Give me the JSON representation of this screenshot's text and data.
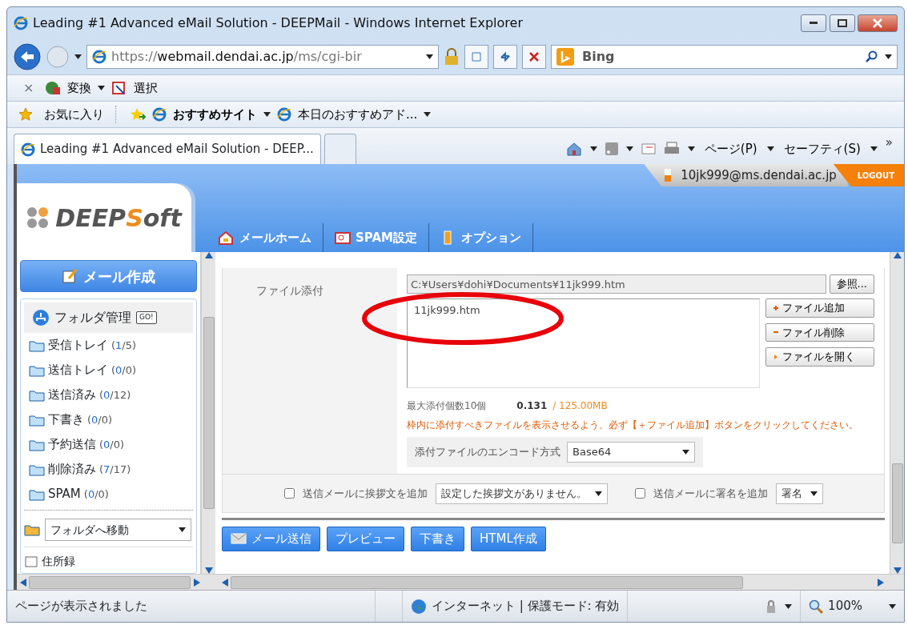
{
  "window": {
    "title": "Leading #1 Advanced eMail Solution - DEEPMail - Windows Internet Explorer"
  },
  "address_bar": {
    "url": "https://**webmail.dendai.ac.jp**/ms/cgi-bir",
    "search_placeholder": "Bing"
  },
  "command_bar": {
    "close_glyph": "×",
    "items": [
      {
        "label": "変換"
      },
      {
        "label": "選択"
      }
    ]
  },
  "favorites_bar": {
    "favorites": "お気に入り",
    "items": [
      {
        "label": "おすすめサイト",
        "kind": "menu"
      },
      {
        "label": "本日のおすすめアド...",
        "kind": "page"
      }
    ]
  },
  "tabs": [
    {
      "label": "Leading #1 Advanced eMail Solution - DEEP...",
      "selected": true
    },
    {
      "selected": false
    }
  ],
  "ie_commands": [
    {
      "label": "ページ(P)"
    },
    {
      "label": "セーフティ(S)"
    }
  ],
  "ie_more": "»",
  "header": {
    "user_email": "10jk999@ms.dendai.ac.jp",
    "logout": "LOGOUT",
    "logo_parts": [
      "DEEP",
      "S",
      "oft"
    ],
    "nav": [
      {
        "label": "メールホーム",
        "kind": "home"
      },
      {
        "label": "SPAM設定",
        "kind": "spam"
      },
      {
        "label": "オプション",
        "kind": "option"
      }
    ]
  },
  "sidebar": {
    "compose": "メール作成",
    "folder_manager": "フォルダ管理",
    "go": "GO!",
    "folders": [
      {
        "name": "受信トレイ",
        "count": "(*1*/5)"
      },
      {
        "name": "送信トレイ",
        "count": "(*0*/0)"
      },
      {
        "name": "送信済み",
        "count": "(*0*/12)"
      },
      {
        "name": "下書き",
        "count": "(*0*/0)"
      },
      {
        "name": "予約送信",
        "count": "(*0*/0)"
      },
      {
        "name": "削除済み",
        "count": "(*7*/17)"
      },
      {
        "name": "SPAM",
        "count": "(*0*/0)"
      }
    ],
    "move_to_folder": "フォルダへ移動",
    "address_book": "住所録"
  },
  "attachment": {
    "label": "ファイル添付",
    "path": "C:¥Users¥dohi¥Documents¥11jk999.htm",
    "browse": "参照...",
    "files": [
      {
        "name": "11jk999.htm",
        "highlighted": true
      }
    ],
    "buttons": [
      {
        "label": "ファイル追加",
        "kind": "add"
      },
      {
        "label": "ファイル削除",
        "kind": "remove"
      },
      {
        "label": "ファイルを開く",
        "kind": "open"
      }
    ],
    "max_count": "最大添付個数10個",
    "used": "0.131",
    "limit": "/ 125.00MB",
    "notice": "枠内に添付すべきファイルを表示させるよう、必ず【＋ファイル追加】ボタンをクリックしてください。",
    "encoding_label": "添付ファイルのエンコード方式",
    "encoding": "Base64"
  },
  "options": {
    "greeting": {
      "label": "送信メールに挨拶文を追加",
      "checked": false,
      "value": "設定した挨拶文がありません。"
    },
    "signature": {
      "label": "送信メールに署名を追加",
      "checked": false,
      "value": "署名"
    }
  },
  "actions": [
    {
      "label": "メール送信",
      "kind": "send"
    },
    {
      "label": "プレビュー",
      "kind": "plain"
    },
    {
      "label": "下書き",
      "kind": "plain"
    },
    {
      "label": "HTML作成",
      "kind": "plain"
    }
  ],
  "status_bar": {
    "message": "ページが表示されました",
    "zone": "インターネット | 保護モード: 有効",
    "zoom": "100%"
  }
}
